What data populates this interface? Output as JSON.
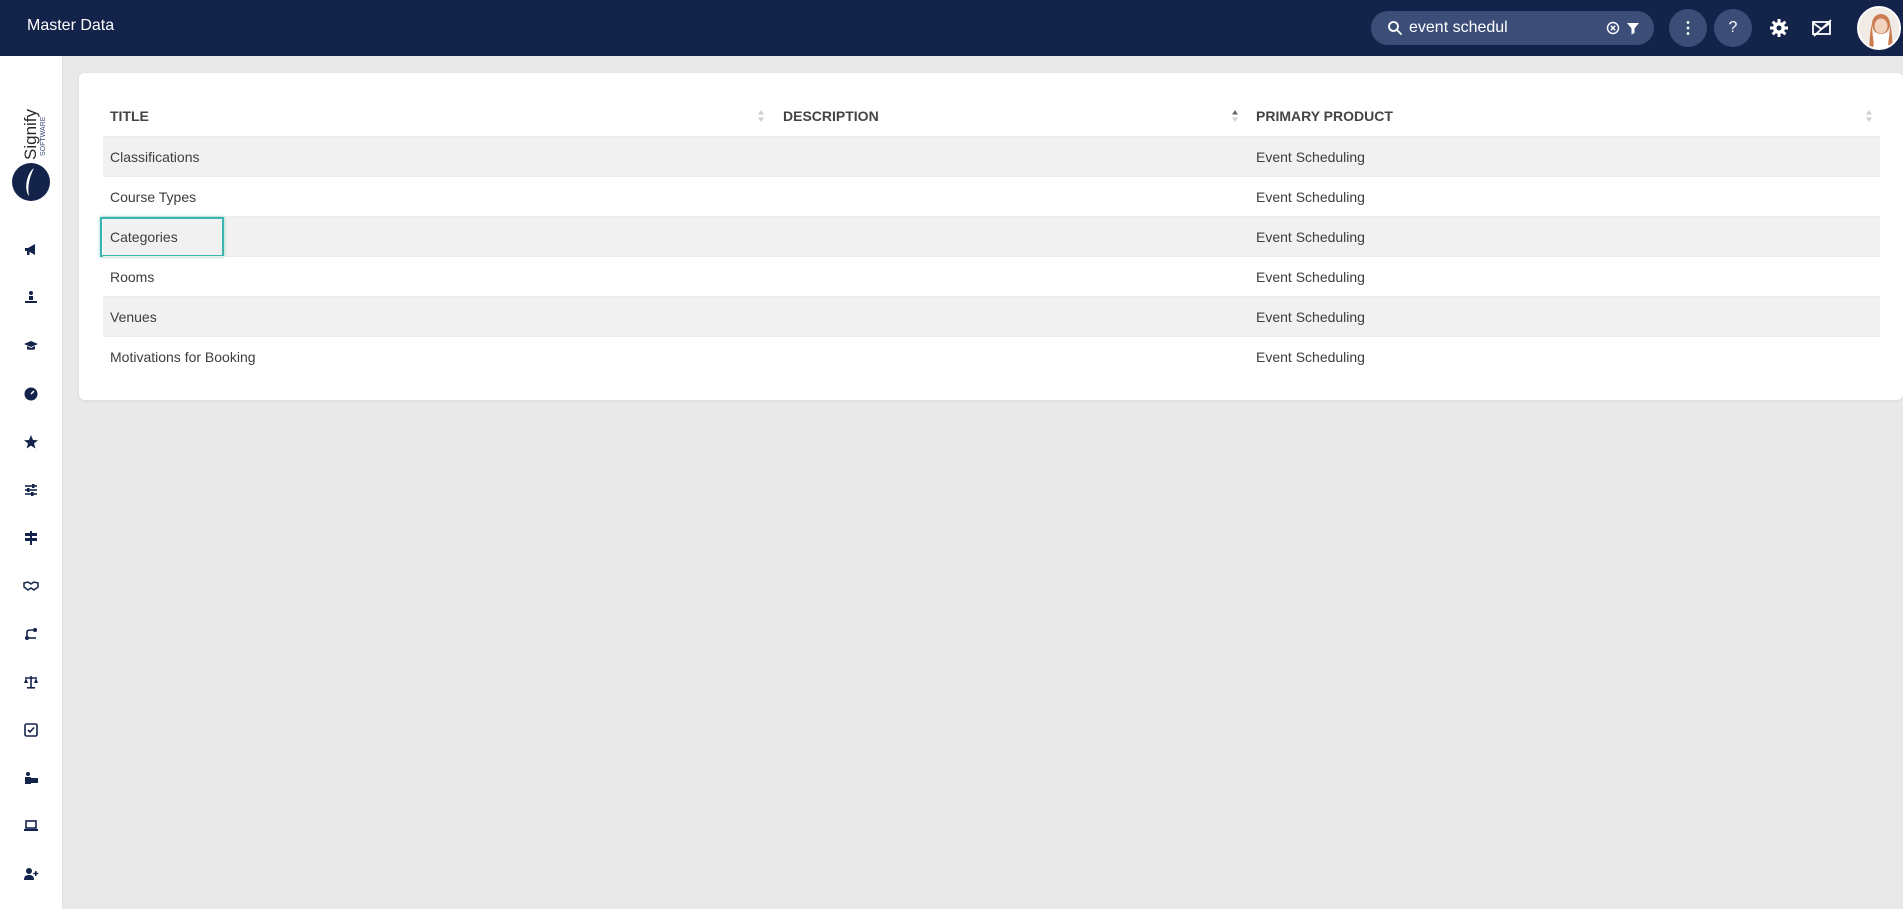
{
  "app": {
    "title": "Master Data"
  },
  "search": {
    "value": "event schedul",
    "icon": "search-icon"
  },
  "header": {
    "more_label": "⋮",
    "help_label": "?"
  },
  "sidebar": {
    "logo_text": "Signify",
    "logo_sub": "SOFTWARE",
    "items": [
      {
        "name": "announcements",
        "icon": "megaphone-icon"
      },
      {
        "name": "training",
        "icon": "person-desk-icon"
      },
      {
        "name": "courses",
        "icon": "graduation-cap-icon"
      },
      {
        "name": "dashboard",
        "icon": "gauge-icon"
      },
      {
        "name": "favourites",
        "icon": "star-icon"
      },
      {
        "name": "settings-sliders",
        "icon": "sliders-icon"
      },
      {
        "name": "signposts",
        "icon": "signpost-icon"
      },
      {
        "name": "partnerships",
        "icon": "handshake-icon"
      },
      {
        "name": "workflows",
        "icon": "branch-icon"
      },
      {
        "name": "compliance",
        "icon": "scales-icon"
      },
      {
        "name": "tasks",
        "icon": "checkbox-icon"
      },
      {
        "name": "learners",
        "icon": "person-laptop-icon"
      },
      {
        "name": "devices",
        "icon": "laptop-icon"
      },
      {
        "name": "add-user",
        "icon": "user-plus-icon"
      }
    ]
  },
  "table": {
    "columns": [
      "TITLE",
      "DESCRIPTION",
      "PRIMARY PRODUCT"
    ],
    "rows": [
      {
        "title": "Classifications",
        "description": "",
        "product": "Event Scheduling"
      },
      {
        "title": "Course Types",
        "description": "",
        "product": "Event Scheduling"
      },
      {
        "title": "Categories",
        "description": "",
        "product": "Event Scheduling"
      },
      {
        "title": "Rooms",
        "description": "",
        "product": "Event Scheduling"
      },
      {
        "title": "Venues",
        "description": "",
        "product": "Event Scheduling"
      },
      {
        "title": "Motivations for Booking",
        "description": "",
        "product": "Event Scheduling"
      }
    ]
  },
  "colors": {
    "topbar": "#13234a",
    "search_bg": "#3c4d78",
    "focus": "#3bb5b0"
  }
}
